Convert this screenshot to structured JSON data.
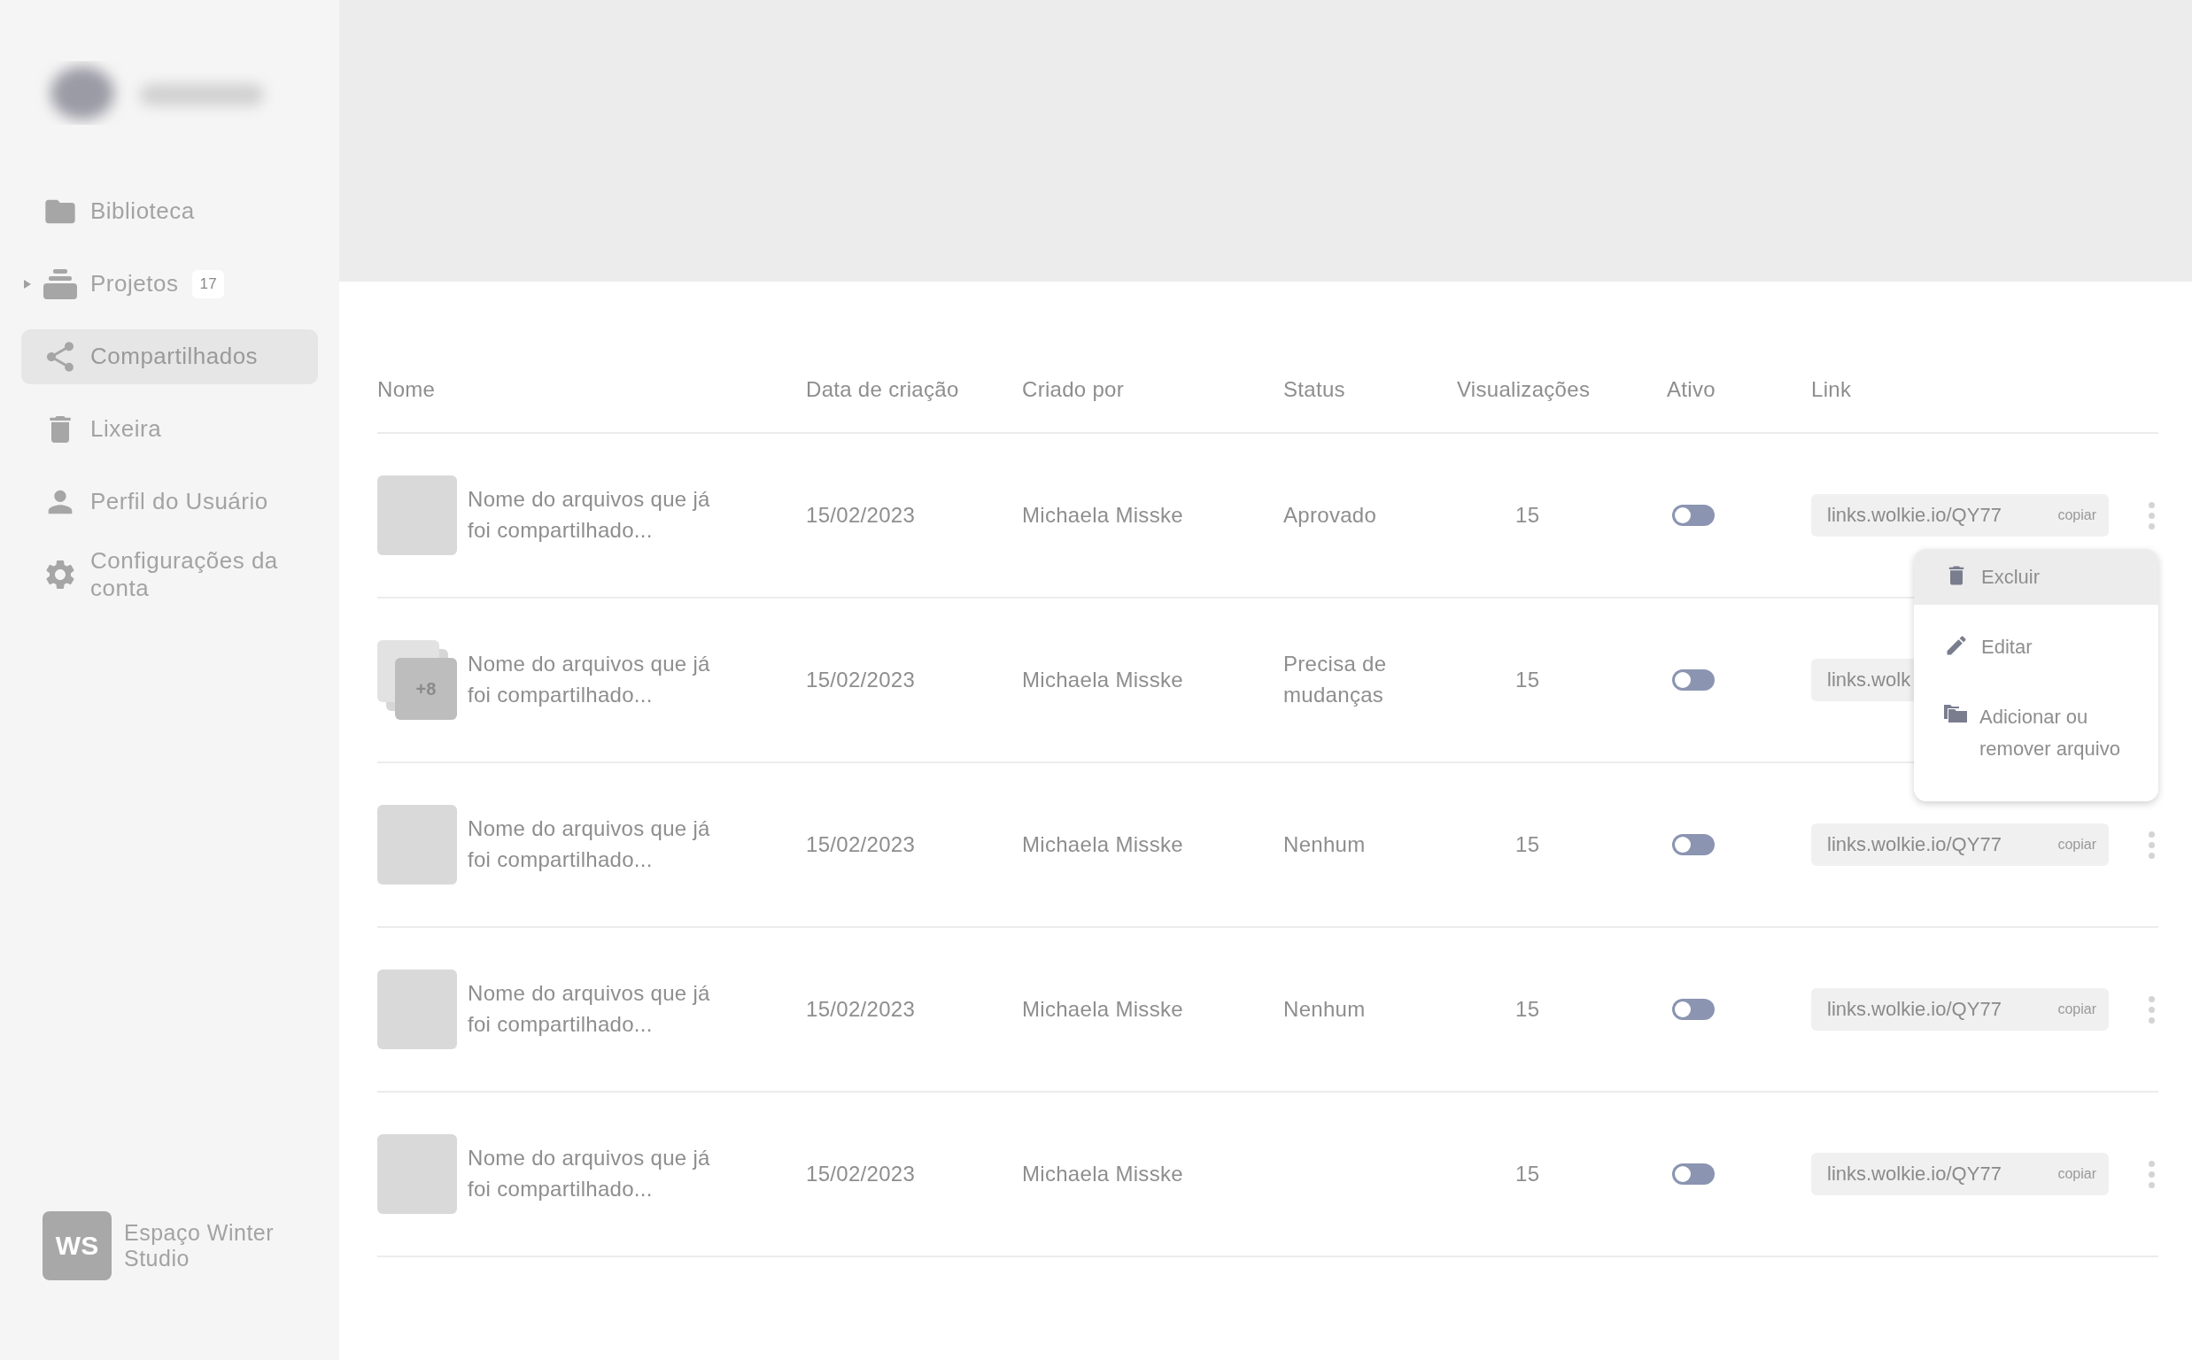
{
  "sidebar": {
    "items": [
      {
        "label": "Biblioteca",
        "selected": false
      },
      {
        "label": "Projetos",
        "selected": false,
        "expanded": false,
        "badge": "17"
      },
      {
        "label": "Compartilhados",
        "selected": true
      },
      {
        "label": "Lixeira",
        "selected": false
      },
      {
        "label": "Perfil do Usuário",
        "selected": false
      },
      {
        "label": "Configurações da conta",
        "selected": false
      }
    ],
    "workspace": {
      "initials": "WS",
      "name": "Espaço Winter Studio"
    }
  },
  "table": {
    "columns": [
      "Nome",
      "Data de criação",
      "Criado por",
      "Status",
      "Visualizações",
      "Ativo",
      "Link"
    ],
    "rows": [
      {
        "thumb": {
          "kind": "single"
        },
        "name": "Nome do arquivos que já foi compartilhado...",
        "date": "15/02/2023",
        "author": "Michaela Misske",
        "status": "Aprovado",
        "views": "15",
        "on": false,
        "link": "links.wolkie.io/QY77",
        "copy": "copiar",
        "menu": {
          "items": [
            {
              "label": "Excluir",
              "selected": true
            },
            {
              "label": "Editar",
              "selected": false
            },
            {
              "label": "Adicionar ou remover arquivo",
              "selected": false
            }
          ]
        }
      },
      {
        "thumb": {
          "kind": "stack",
          "count": "+8"
        },
        "name": "Nome do arquivos que já foi compartilhado...",
        "date": "15/02/2023",
        "author": "Michaela Misske",
        "status": "Precisa de mudanças",
        "views": "15",
        "on": false,
        "link": "links.wolk"
      },
      {
        "thumb": {
          "kind": "single"
        },
        "name": "Nome do arquivos que já foi compartilhado...",
        "date": "15/02/2023",
        "author": "Michaela Misske",
        "status": "Nenhum",
        "views": "15",
        "on": false,
        "link": "links.wolkie.io/QY77",
        "copy": "copiar"
      },
      {
        "thumb": {
          "kind": "single"
        },
        "name": "Nome do arquivos que já foi compartilhado...",
        "date": "15/02/2023",
        "author": "Michaela Misske",
        "status": "Nenhum",
        "views": "15",
        "on": false,
        "link": "links.wolkie.io/QY77",
        "copy": "copiar"
      },
      {
        "thumb": {
          "kind": "single"
        },
        "name": "Nome do arquivos que já foi compartilhado...",
        "date": "15/02/2023",
        "author": "Michaela Misske",
        "views": "15",
        "on": false,
        "link": "links.wolkie.io/QY77",
        "copy": "copiar"
      }
    ]
  }
}
